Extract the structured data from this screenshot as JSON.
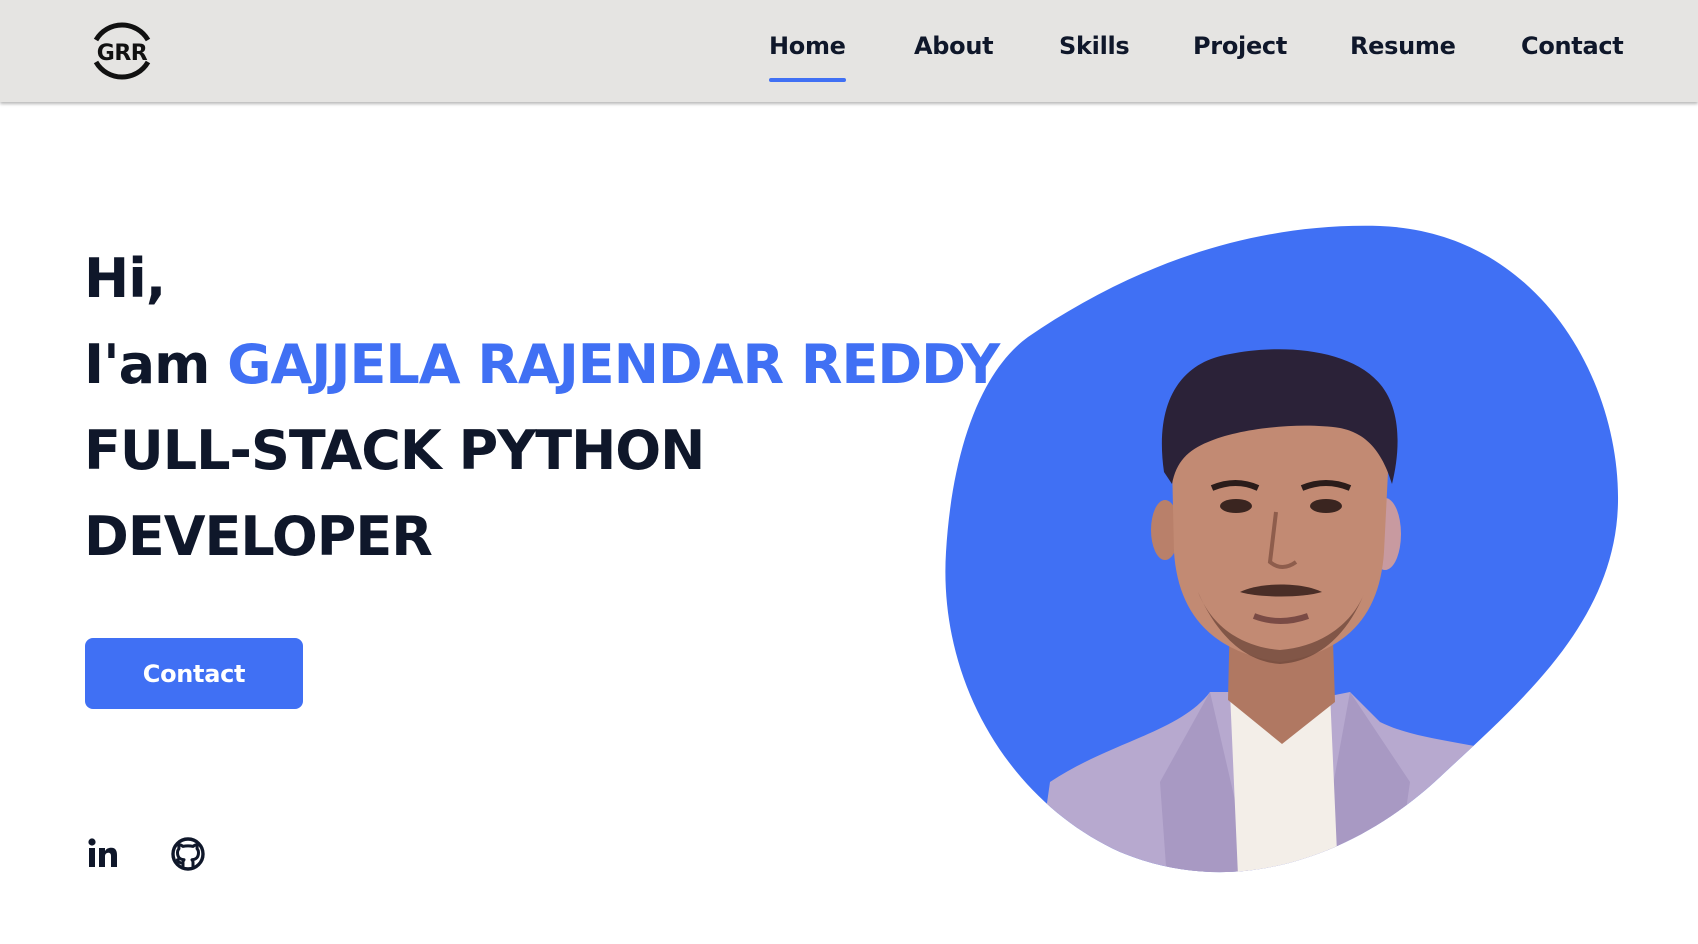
{
  "logo": {
    "text": "GRR",
    "icon": "grr-logo"
  },
  "nav": {
    "items": [
      {
        "label": "Home",
        "active": true
      },
      {
        "label": "About",
        "active": false
      },
      {
        "label": "Skills",
        "active": false
      },
      {
        "label": "Project",
        "active": false
      },
      {
        "label": "Resume",
        "active": false
      },
      {
        "label": "Contact",
        "active": false
      }
    ]
  },
  "hero": {
    "greeting": "Hi,",
    "intro_prefix": "I'am",
    "name": "GAJJELA RAJENDAR REDDY",
    "title_line1": "FULL-STACK PYTHON",
    "title_line2": "DEVELOPER",
    "contact_button": "Contact"
  },
  "social": [
    {
      "name": "linkedin",
      "icon": "linkedin-icon"
    },
    {
      "name": "github",
      "icon": "github-icon"
    }
  ],
  "colors": {
    "accent": "#4070f4",
    "header_bg": "#e5e4e2",
    "text_dark": "#0f172a",
    "blob": "#4070f4"
  }
}
